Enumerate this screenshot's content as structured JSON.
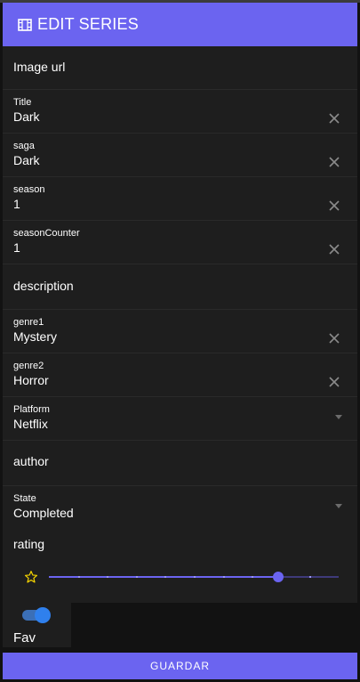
{
  "header": {
    "title": "EDIT SERIES",
    "icon": "film-icon"
  },
  "form": {
    "image_url_placeholder": "Image url",
    "title": {
      "label": "Title",
      "value": "Dark"
    },
    "saga": {
      "label": "saga",
      "value": "Dark"
    },
    "season": {
      "label": "season",
      "value": "1"
    },
    "seasonCounter": {
      "label": "seasonCounter",
      "value": "1"
    },
    "description_placeholder": "description",
    "genre1": {
      "label": "genre1",
      "value": "Mystery"
    },
    "genre2": {
      "label": "genre2",
      "value": "Horror"
    },
    "platform": {
      "label": "Platform",
      "value": "Netflix"
    },
    "author_placeholder": "author",
    "state": {
      "label": "State",
      "value": "Completed"
    },
    "rating": {
      "label": "rating",
      "fraction": 0.79,
      "ticks": 10
    },
    "fav": {
      "label": "Fav",
      "on": true
    }
  },
  "actions": {
    "save_label": "GUARDAR"
  },
  "colors": {
    "accent": "#6b64f0",
    "toggle": "#2f80ed",
    "star": "#f5d400",
    "panel": "#1e1e1e"
  }
}
